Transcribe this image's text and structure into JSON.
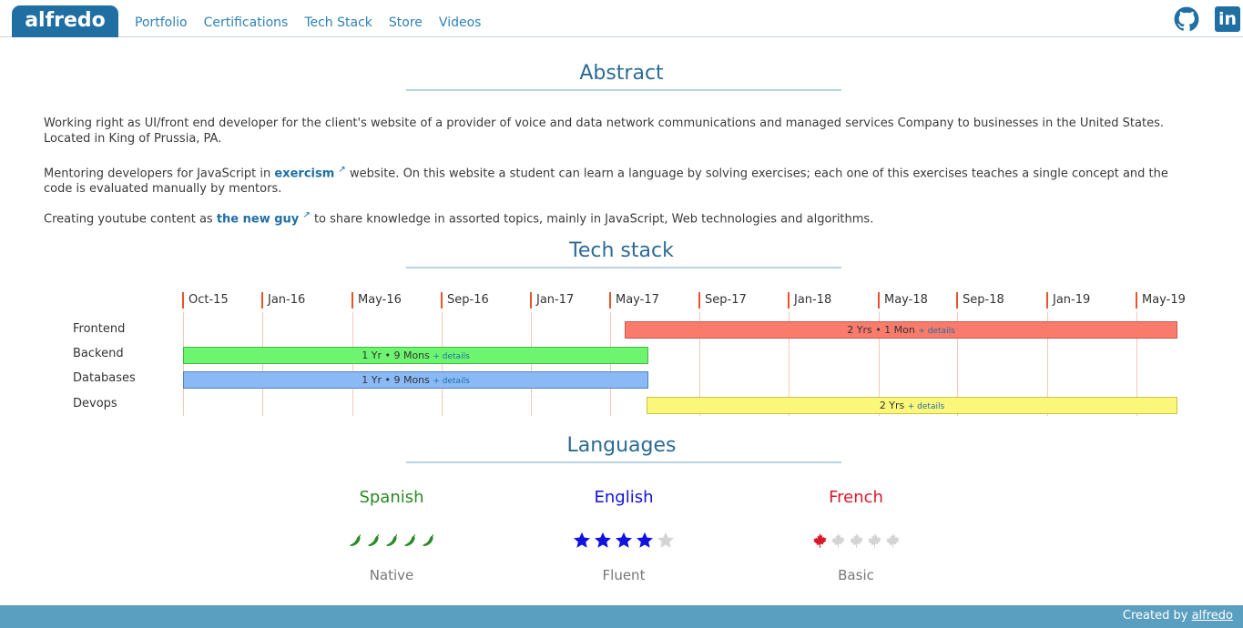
{
  "header": {
    "brand": "alfredo",
    "nav": [
      "Portfolio",
      "Certifications",
      "Tech Stack",
      "Store",
      "Videos"
    ],
    "social": {
      "github_icon": "github-icon",
      "linkedin_label": "in"
    }
  },
  "abstract": {
    "title": "Abstract",
    "p1": "Working right as UI/front end developer for the client's website of a provider of voice and data network communications and managed services Company to businesses in the United States. Located in King of Prussia, PA.",
    "p2_before": "Mentoring developers for JavaScript in ",
    "p2_link": "exercism",
    "p2_after": " website. On this website a student can learn a language by solving exercises; each one of this exercises teaches a single concept and the code is evaluated manually by mentors.",
    "p3_before": "Creating youtube content as ",
    "p3_link": "the new guy",
    "p3_after": " to share knowledge in assorted topics, mainly in JavaScript, Web technologies and algorithms."
  },
  "tech_stack": {
    "title": "Tech stack",
    "ticks": [
      "Oct-15",
      "Jan-16",
      "May-16",
      "Sep-16",
      "Jan-17",
      "May-17",
      "Sep-17",
      "Jan-18",
      "May-18",
      "Sep-18",
      "Jan-19",
      "May-19"
    ],
    "rows": [
      {
        "label": "Frontend",
        "duration": "2 Yrs • 1 Mon",
        "details": "+ details"
      },
      {
        "label": "Backend",
        "duration": "1 Yr • 9 Mons",
        "details": "+ details"
      },
      {
        "label": "Databases",
        "duration": "1 Yr • 9 Mons",
        "details": "+ details"
      },
      {
        "label": "Devops",
        "duration": "2 Yrs",
        "details": "+ details"
      }
    ],
    "colors": {
      "frontend": "#f97b6b",
      "backend": "#6df56f",
      "databases": "#8ab9f6",
      "devops": "#fbf77a"
    }
  },
  "languages": {
    "title": "Languages",
    "items": [
      {
        "name": "Spanish",
        "level": "Native",
        "rating": 5,
        "max": 5,
        "icon": "chili-pepper-icon",
        "color": "#2a8a26"
      },
      {
        "name": "English",
        "level": "Fluent",
        "rating": 4,
        "max": 5,
        "icon": "star-icon",
        "color": "#1212e0"
      },
      {
        "name": "French",
        "level": "Basic",
        "rating": 1,
        "max": 5,
        "icon": "maple-leaf-icon",
        "color": "#d9192a"
      }
    ]
  },
  "footer": {
    "prefix": "Created by ",
    "link": "alfredo"
  }
}
